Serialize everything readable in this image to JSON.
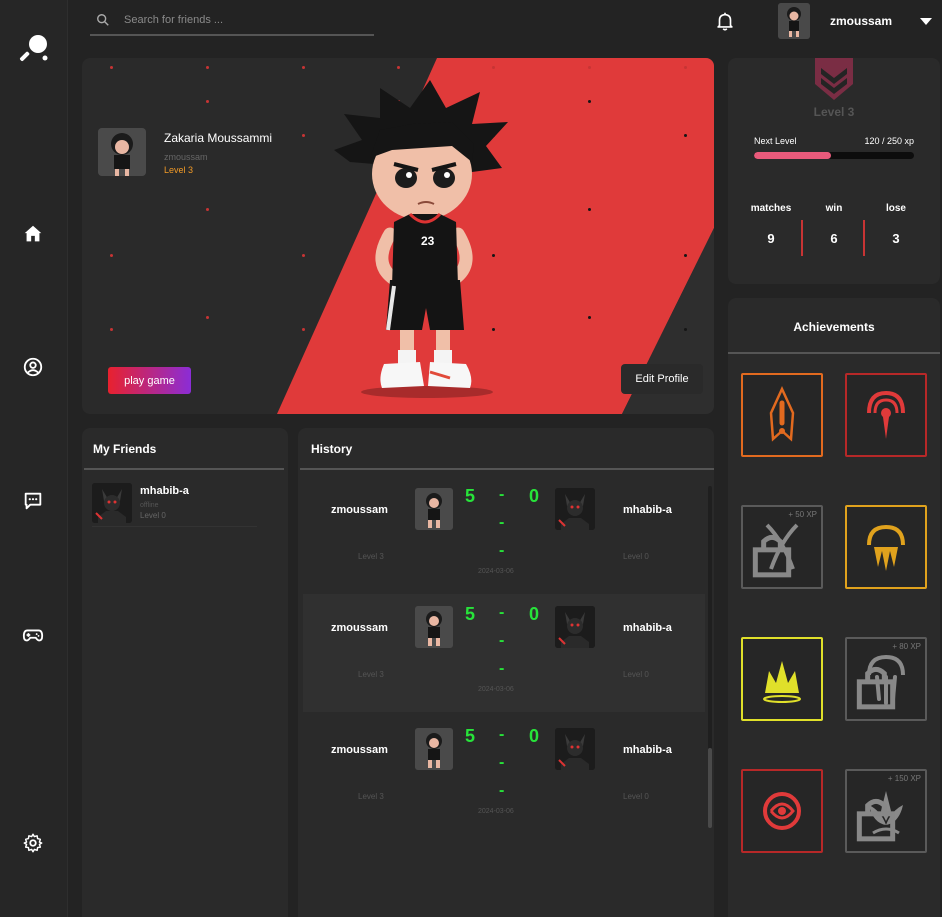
{
  "search": {
    "placeholder": "Search for friends ..."
  },
  "header": {
    "username": "zmoussam"
  },
  "hero": {
    "name": "Zakaria Moussammi",
    "handle": "zmoussam",
    "level": "Level 3",
    "play_label": "play game",
    "edit_label": "Edit Profile"
  },
  "level_panel": {
    "level": "Level 3",
    "next_level_label": "Next Level",
    "xp_text": "120 / 250 xp",
    "xp_progress": 0.48,
    "stats": [
      {
        "label": "matches",
        "value": "9"
      },
      {
        "label": "win",
        "value": "6"
      },
      {
        "label": "lose",
        "value": "3"
      }
    ]
  },
  "achievements": {
    "title": "Achievements",
    "items": [
      {
        "icon": "rocket-badge-icon",
        "xp": "",
        "locked": false,
        "color": "#e26a1f"
      },
      {
        "icon": "target-badge-icon",
        "xp": "",
        "locked": false,
        "color": "#b72828"
      },
      {
        "icon": "crossed-swords-badge-icon",
        "xp": "+ 50 XP",
        "locked": true,
        "color": "#5a5a5a"
      },
      {
        "icon": "flame-arc-badge-icon",
        "xp": "",
        "locked": false,
        "color": "#e0a21d"
      },
      {
        "icon": "crown-splash-badge-icon",
        "xp": "",
        "locked": false,
        "color": "#e0e02a"
      },
      {
        "icon": "jellyfish-badge-icon",
        "xp": "+ 80 XP",
        "locked": true,
        "color": "#5a5a5a"
      },
      {
        "icon": "spiral-badge-icon",
        "xp": "",
        "locked": false,
        "color": "#b72828"
      },
      {
        "icon": "lotus-badge-icon",
        "xp": "+ 150 XP",
        "locked": true,
        "color": "#5a5a5a"
      }
    ]
  },
  "friends": {
    "title": "My Friends",
    "list": [
      {
        "name": "mhabib-a",
        "status": "offline",
        "level": "Level 0"
      }
    ]
  },
  "history": {
    "title": "History",
    "matches": [
      {
        "player1": "zmoussam",
        "player2": "mhabib-a",
        "score1": "5",
        "score2": "0",
        "level1": "Level 3",
        "level2": "Level 0",
        "date": "2024-03-06"
      },
      {
        "player1": "zmoussam",
        "player2": "mhabib-a",
        "score1": "5",
        "score2": "0",
        "level1": "Level 3",
        "level2": "Level 0",
        "date": "2024-03-06"
      },
      {
        "player1": "zmoussam",
        "player2": "mhabib-a",
        "score1": "5",
        "score2": "0",
        "level1": "Level 3",
        "level2": "Level 0",
        "date": "2024-03-06"
      }
    ]
  },
  "colors": {
    "accent_red": "#e03a3a",
    "score_green": "#27e33a",
    "level_orange": "#f19a27",
    "xp_pink": "#e95a7b"
  },
  "sidebar": {
    "items": [
      {
        "icon": "ping-pong-logo-icon"
      },
      {
        "icon": "home-icon"
      },
      {
        "icon": "profile-icon"
      },
      {
        "icon": "chat-icon"
      },
      {
        "icon": "gamepad-icon"
      },
      {
        "icon": "settings-icon"
      }
    ]
  }
}
